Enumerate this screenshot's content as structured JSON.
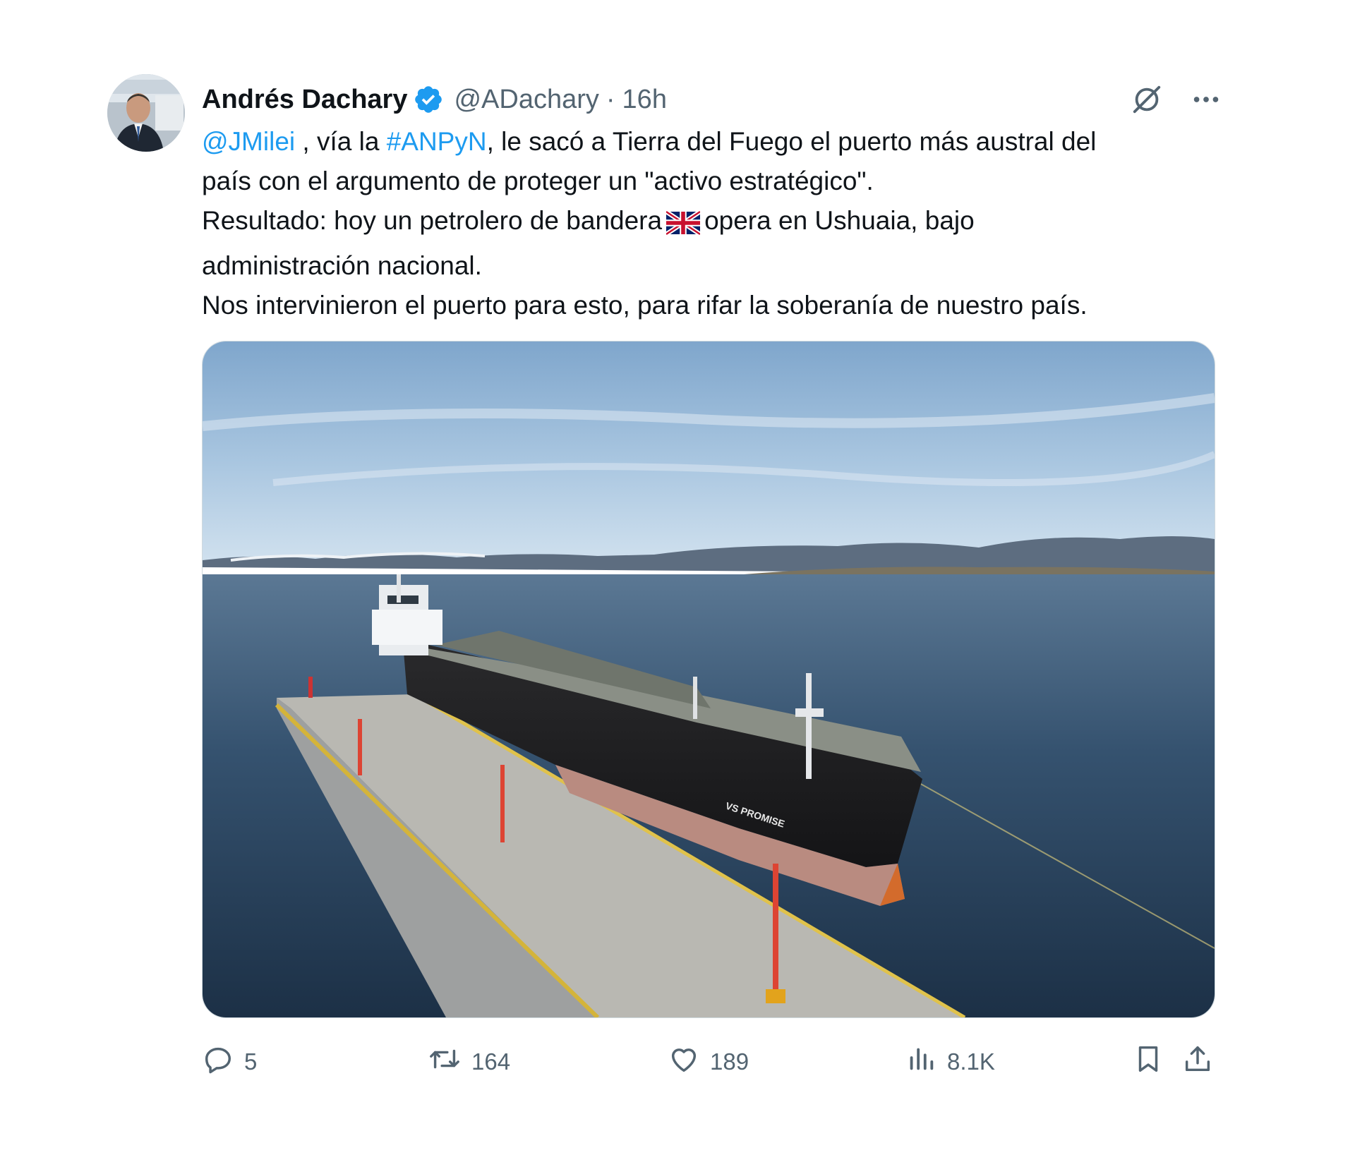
{
  "tweet": {
    "author": {
      "display_name": "Andrés Dachary",
      "handle": "@ADachary",
      "verified": true,
      "verified_color": "#1d9bf0",
      "avatar_icon": "profile-photo"
    },
    "separator": "·",
    "time": "16h",
    "text": {
      "line1": {
        "mention": "@JMilei",
        "part1": " , vía la ",
        "hashtag": "#ANPyN",
        "part2": ", le sacó a Tierra del Fuego el puerto más austral del"
      },
      "line2": "país con el argumento de proteger un \"activo estratégico\".",
      "line3": {
        "before_flag": "Resultado: hoy un petrolero de bandera",
        "flag_icon": "uk-flag",
        "after_flag": "opera en Ushuaia, bajo"
      },
      "line4": "administración nacional.",
      "line5": "Nos intervinieron el puerto para esto, para rifar la soberanía de nuestro país."
    },
    "media": {
      "ship_name": "VS PROMISE"
    },
    "metrics": {
      "replies": "5",
      "retweets": "164",
      "likes": "189",
      "views": "8.1K"
    },
    "colors": {
      "link": "#1d9bf0",
      "secondary_text": "#536471"
    }
  }
}
